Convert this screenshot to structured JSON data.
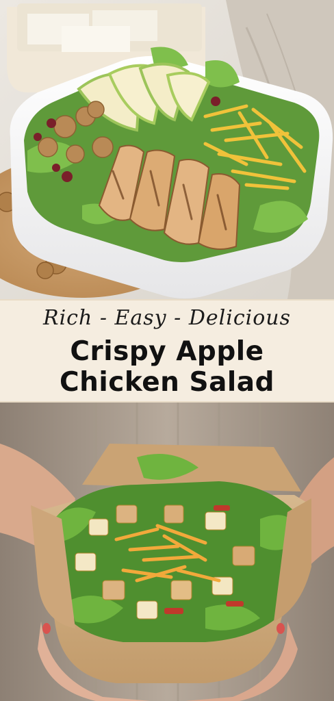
{
  "banner": {
    "tagline": "Rich - Easy - Delicious",
    "title_line_1": "Crispy Apple",
    "title_line_2": "Chicken Salad"
  },
  "colors": {
    "banner_background": "#f5ede0",
    "title_text": "#111111"
  },
  "images": {
    "top": "chicken-salad-container-photo",
    "bottom": "salad-paper-box-photo"
  }
}
